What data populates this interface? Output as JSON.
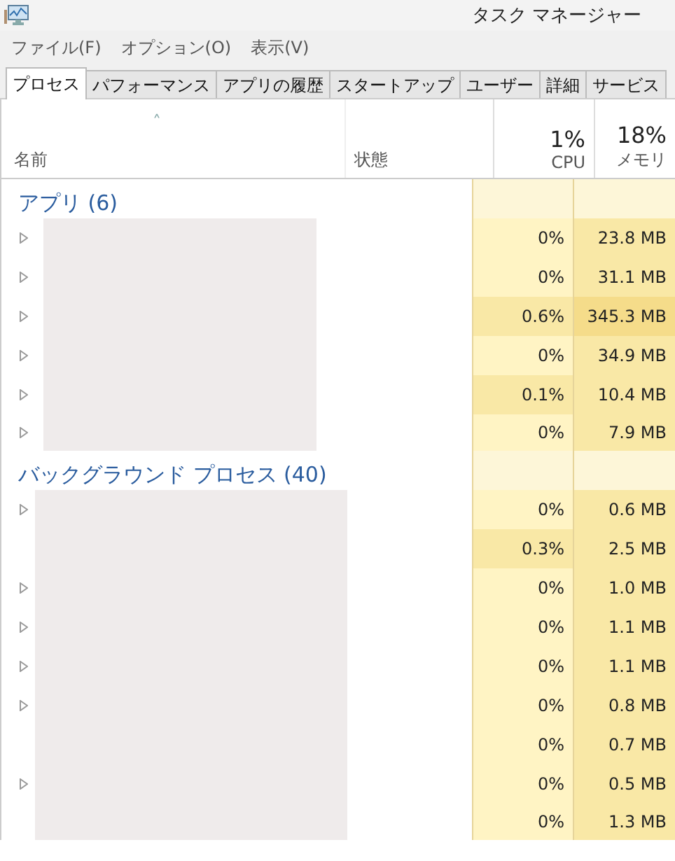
{
  "window": {
    "title": "タスク マネージャー"
  },
  "menu": [
    "ファイル(F)",
    "オプション(O)",
    "表示(V)"
  ],
  "tabs": [
    {
      "label": "プロセス",
      "selected": true
    },
    {
      "label": "パフォーマンス",
      "selected": false
    },
    {
      "label": "アプリの履歴",
      "selected": false
    },
    {
      "label": "スタートアップ",
      "selected": false
    },
    {
      "label": "ユーザー",
      "selected": false
    },
    {
      "label": "詳細",
      "selected": false
    },
    {
      "label": "サービス",
      "selected": false
    }
  ],
  "sort_indicator": "˄",
  "columns": {
    "name": "名前",
    "status": "状態",
    "cpu": {
      "total": "1%",
      "label": "CPU"
    },
    "memory": {
      "total": "18%",
      "label": "メモリ"
    }
  },
  "groups": [
    {
      "title": "アプリ (6)",
      "rows": [
        {
          "expandable": true,
          "cpu": {
            "value": "0%",
            "color": "#fff4c4"
          },
          "memory": {
            "value": "23.8 MB",
            "color": "#f9e8a6"
          }
        },
        {
          "expandable": true,
          "cpu": {
            "value": "0%",
            "color": "#fff4c4"
          },
          "memory": {
            "value": "31.1 MB",
            "color": "#f9e8a6"
          }
        },
        {
          "expandable": true,
          "cpu": {
            "value": "0.6%",
            "color": "#f9e8a6"
          },
          "memory": {
            "value": "345.3 MB",
            "color": "#f5dc8a"
          }
        },
        {
          "expandable": true,
          "cpu": {
            "value": "0%",
            "color": "#fff4c4"
          },
          "memory": {
            "value": "34.9 MB",
            "color": "#f9e8a6"
          }
        },
        {
          "expandable": true,
          "cpu": {
            "value": "0.1%",
            "color": "#f9e8a6"
          },
          "memory": {
            "value": "10.4 MB",
            "color": "#f9e8a6"
          }
        },
        {
          "expandable": true,
          "cpu": {
            "value": "0%",
            "color": "#fff4c4"
          },
          "memory": {
            "value": "7.9 MB",
            "color": "#f9e8a6"
          }
        }
      ]
    },
    {
      "title": "バックグラウンド プロセス (40)",
      "rows": [
        {
          "expandable": true,
          "cpu": {
            "value": "0%",
            "color": "#fff4c4"
          },
          "memory": {
            "value": "0.6 MB",
            "color": "#f9e8a6"
          }
        },
        {
          "expandable": false,
          "cpu": {
            "value": "0.3%",
            "color": "#f9e8a6"
          },
          "memory": {
            "value": "2.5 MB",
            "color": "#f9e8a6"
          }
        },
        {
          "expandable": true,
          "cpu": {
            "value": "0%",
            "color": "#fff4c4"
          },
          "memory": {
            "value": "1.0 MB",
            "color": "#f9e8a6"
          }
        },
        {
          "expandable": true,
          "cpu": {
            "value": "0%",
            "color": "#fff4c4"
          },
          "memory": {
            "value": "1.1 MB",
            "color": "#f9e8a6"
          }
        },
        {
          "expandable": true,
          "cpu": {
            "value": "0%",
            "color": "#fff4c4"
          },
          "memory": {
            "value": "1.1 MB",
            "color": "#f9e8a6"
          }
        },
        {
          "expandable": true,
          "cpu": {
            "value": "0%",
            "color": "#fff4c4"
          },
          "memory": {
            "value": "0.8 MB",
            "color": "#f9e8a6"
          }
        },
        {
          "expandable": false,
          "cpu": {
            "value": "0%",
            "color": "#fff4c4"
          },
          "memory": {
            "value": "0.7 MB",
            "color": "#f9e8a6"
          }
        },
        {
          "expandable": true,
          "cpu": {
            "value": "0%",
            "color": "#fff4c4"
          },
          "memory": {
            "value": "0.5 MB",
            "color": "#f9e8a6"
          }
        },
        {
          "expandable": false,
          "cpu": {
            "value": "0%",
            "color": "#fff4c4"
          },
          "memory": {
            "value": "1.3 MB",
            "color": "#f9e8a6"
          }
        }
      ]
    }
  ]
}
